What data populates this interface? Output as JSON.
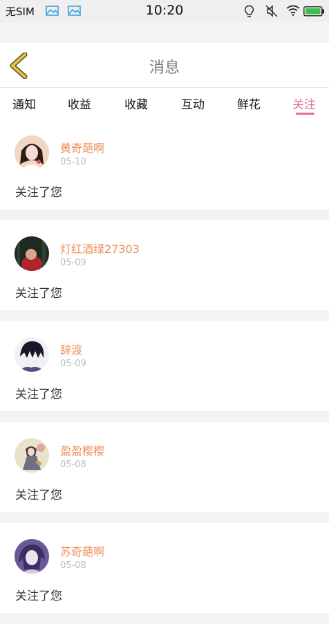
{
  "status_bar": {
    "carrier": "无SIM",
    "time": "10:20",
    "icons": [
      "image-icon",
      "image-icon",
      "bulb-icon",
      "mute-icon",
      "wifi-icon",
      "battery-icon"
    ],
    "battery_color": "#35c24a"
  },
  "header": {
    "title": "消息",
    "back_icon": "chevron-left-icon",
    "back_color": "#e8c43a"
  },
  "tabs": [
    {
      "label": "通知",
      "active": false
    },
    {
      "label": "收益",
      "active": false
    },
    {
      "label": "收藏",
      "active": false
    },
    {
      "label": "互动",
      "active": false
    },
    {
      "label": "鲜花",
      "active": false
    },
    {
      "label": "关注",
      "active": true
    }
  ],
  "accent_color": "#e96a98",
  "name_color": "#ee8d59",
  "follows": [
    {
      "name": "黄奇葩啊",
      "date": "05-10",
      "text": "关注了您"
    },
    {
      "name": "灯红酒绿27303",
      "date": "05-09",
      "text": "关注了您"
    },
    {
      "name": "辞渡",
      "date": "05-09",
      "text": "关注了您"
    },
    {
      "name": "盈盈樱樱",
      "date": "05-08",
      "text": "关注了您"
    },
    {
      "name": "苏奇葩啊",
      "date": "05-08",
      "text": "关注了您"
    }
  ]
}
